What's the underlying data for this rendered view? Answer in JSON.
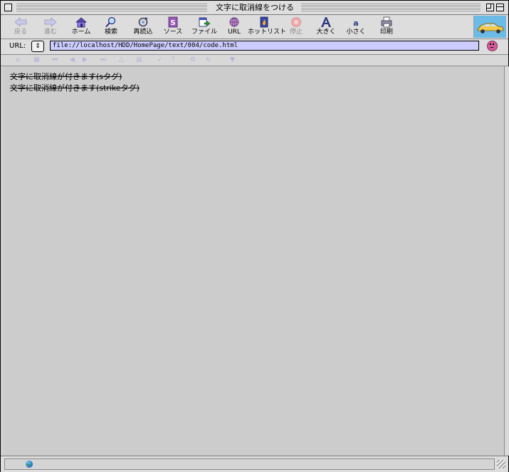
{
  "window": {
    "title": "文字に取消線をつける"
  },
  "toolbar": {
    "buttons": [
      {
        "label": "戻る",
        "icon": "back-arrow-icon",
        "enabled": false
      },
      {
        "label": "進む",
        "icon": "forward-arrow-icon",
        "enabled": false
      },
      {
        "label": "ホーム",
        "icon": "home-icon",
        "enabled": true
      },
      {
        "label": "検索",
        "icon": "search-icon",
        "enabled": true
      },
      {
        "label": "再読込",
        "icon": "reload-icon",
        "enabled": true
      },
      {
        "label": "ソース",
        "icon": "source-icon",
        "enabled": true
      },
      {
        "label": "ファイル",
        "icon": "file-icon",
        "enabled": true
      },
      {
        "label": "URL",
        "icon": "url-globe-icon",
        "enabled": true
      },
      {
        "label": "ホットリスト",
        "icon": "hotlist-icon",
        "enabled": true
      },
      {
        "label": "停止",
        "icon": "stop-icon",
        "enabled": false
      },
      {
        "label": "大きく",
        "icon": "larger-text-icon",
        "enabled": true
      },
      {
        "label": "小さく",
        "icon": "smaller-text-icon",
        "enabled": true
      },
      {
        "label": "印刷",
        "icon": "print-icon",
        "enabled": true
      }
    ]
  },
  "url_bar": {
    "label": "URL:",
    "value": "file://localhost/HDD/HomePage/text/004/code.html"
  },
  "content": {
    "lines": [
      "文字に取消線が付きます(sタグ)",
      "文字に取消線が付きます(strikeタグ)"
    ]
  },
  "colors": {
    "url_field": "#ccccff",
    "throbber": "#6cbbe6",
    "page_background": "#cccccc"
  }
}
